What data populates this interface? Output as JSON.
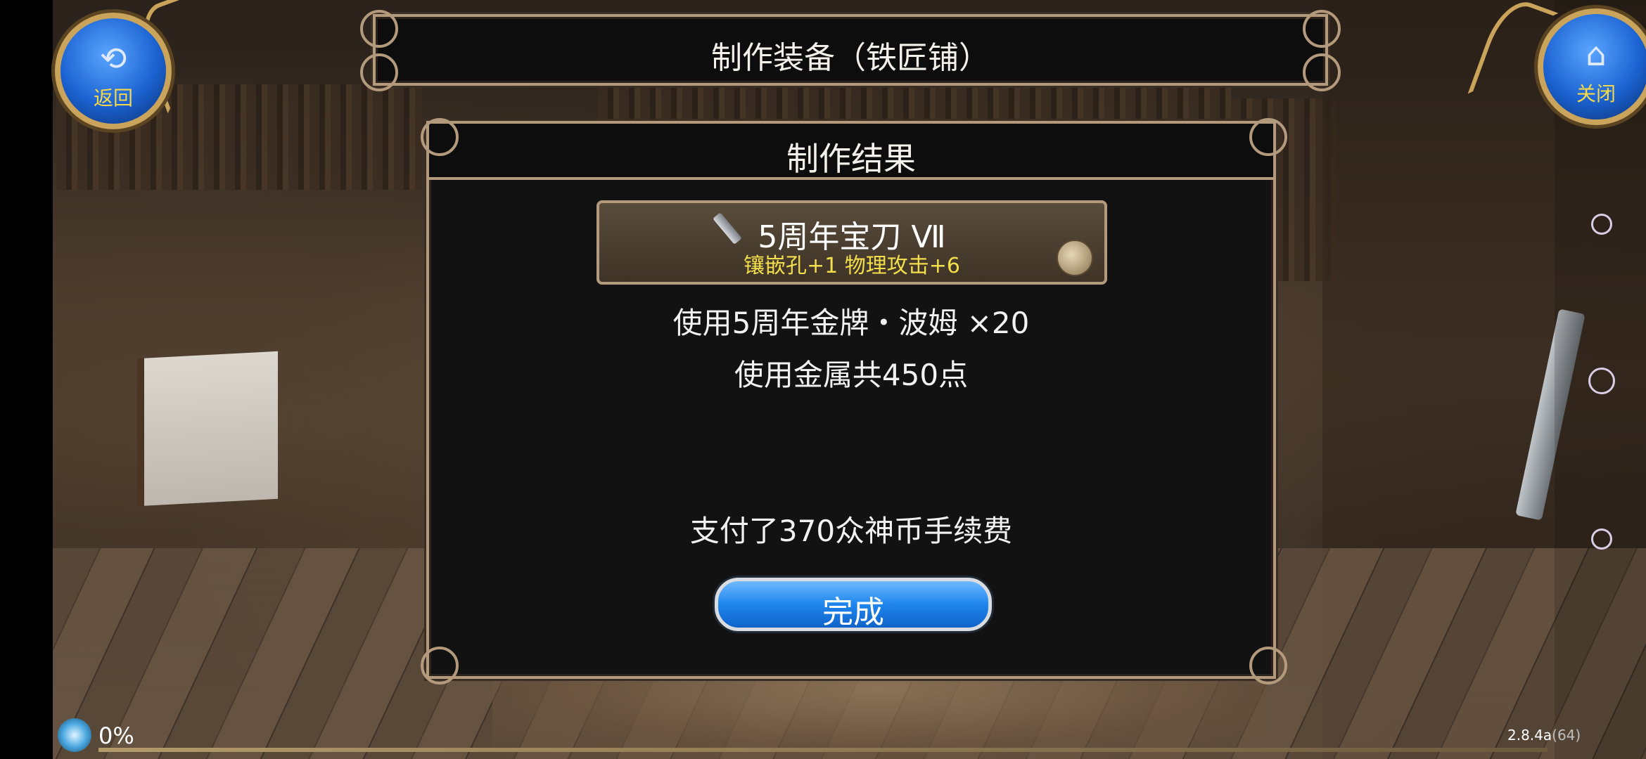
{
  "window": {
    "title": "制作装备（铁匠铺）"
  },
  "buttons": {
    "back_label": "返回",
    "close_label": "关闭"
  },
  "result": {
    "title": "制作结果",
    "item": {
      "name": "5周年宝刀 Ⅶ",
      "stats": "镶嵌孔+1 物理攻击+6"
    },
    "used_medal": "使用5周年金牌・波姆 ×20",
    "used_metal": "使用金属共450点",
    "fee": "支付了370众神币手续费",
    "done_label": "完成"
  },
  "status": {
    "progress": "0%",
    "version": "2.8.4a",
    "build": "(64)"
  },
  "icons": [
    "back-arrow-icon",
    "home-icon",
    "sword-icon",
    "anvil-icon",
    "progress-orb-icon"
  ],
  "colors": {
    "accent_blue": "#1f86ee",
    "gold_text": "#f3de4b",
    "frame_bronze": "#b49a7c"
  }
}
